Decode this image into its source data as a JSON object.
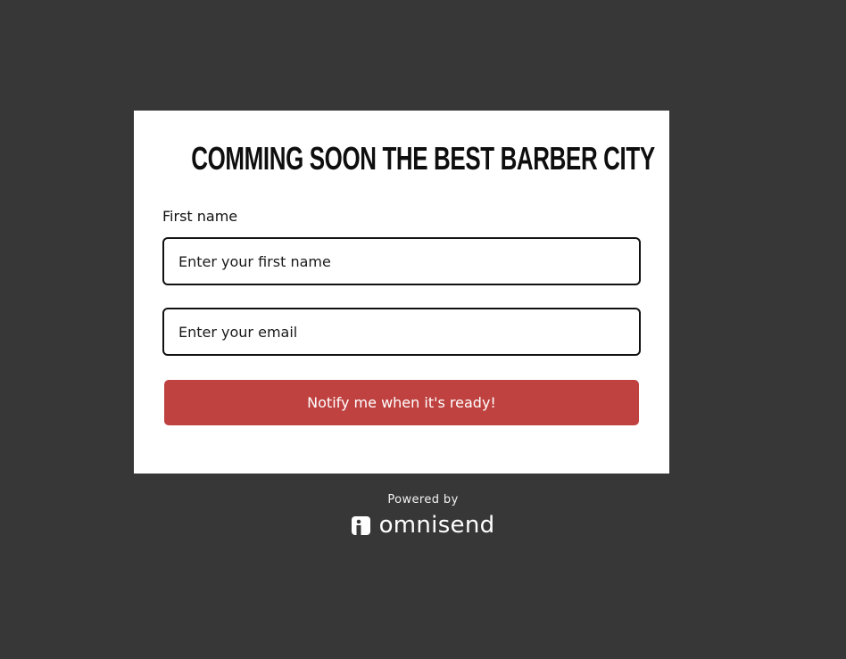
{
  "form": {
    "title": "COMMING SOON THE BEST BARBER CITY",
    "first_name_label": "First name",
    "first_name_placeholder": "Enter your first name",
    "first_name_value": "",
    "email_placeholder": "Enter your email",
    "email_value": "",
    "submit_label": "Notify me when it's ready!"
  },
  "footer": {
    "powered_by": "Powered by",
    "brand_name": "omnisend",
    "brand_icon": "omnisend-logo-icon"
  },
  "colors": {
    "background": "#373737",
    "card": "#ffffff",
    "button": "#bf4240",
    "text": "#111111"
  }
}
